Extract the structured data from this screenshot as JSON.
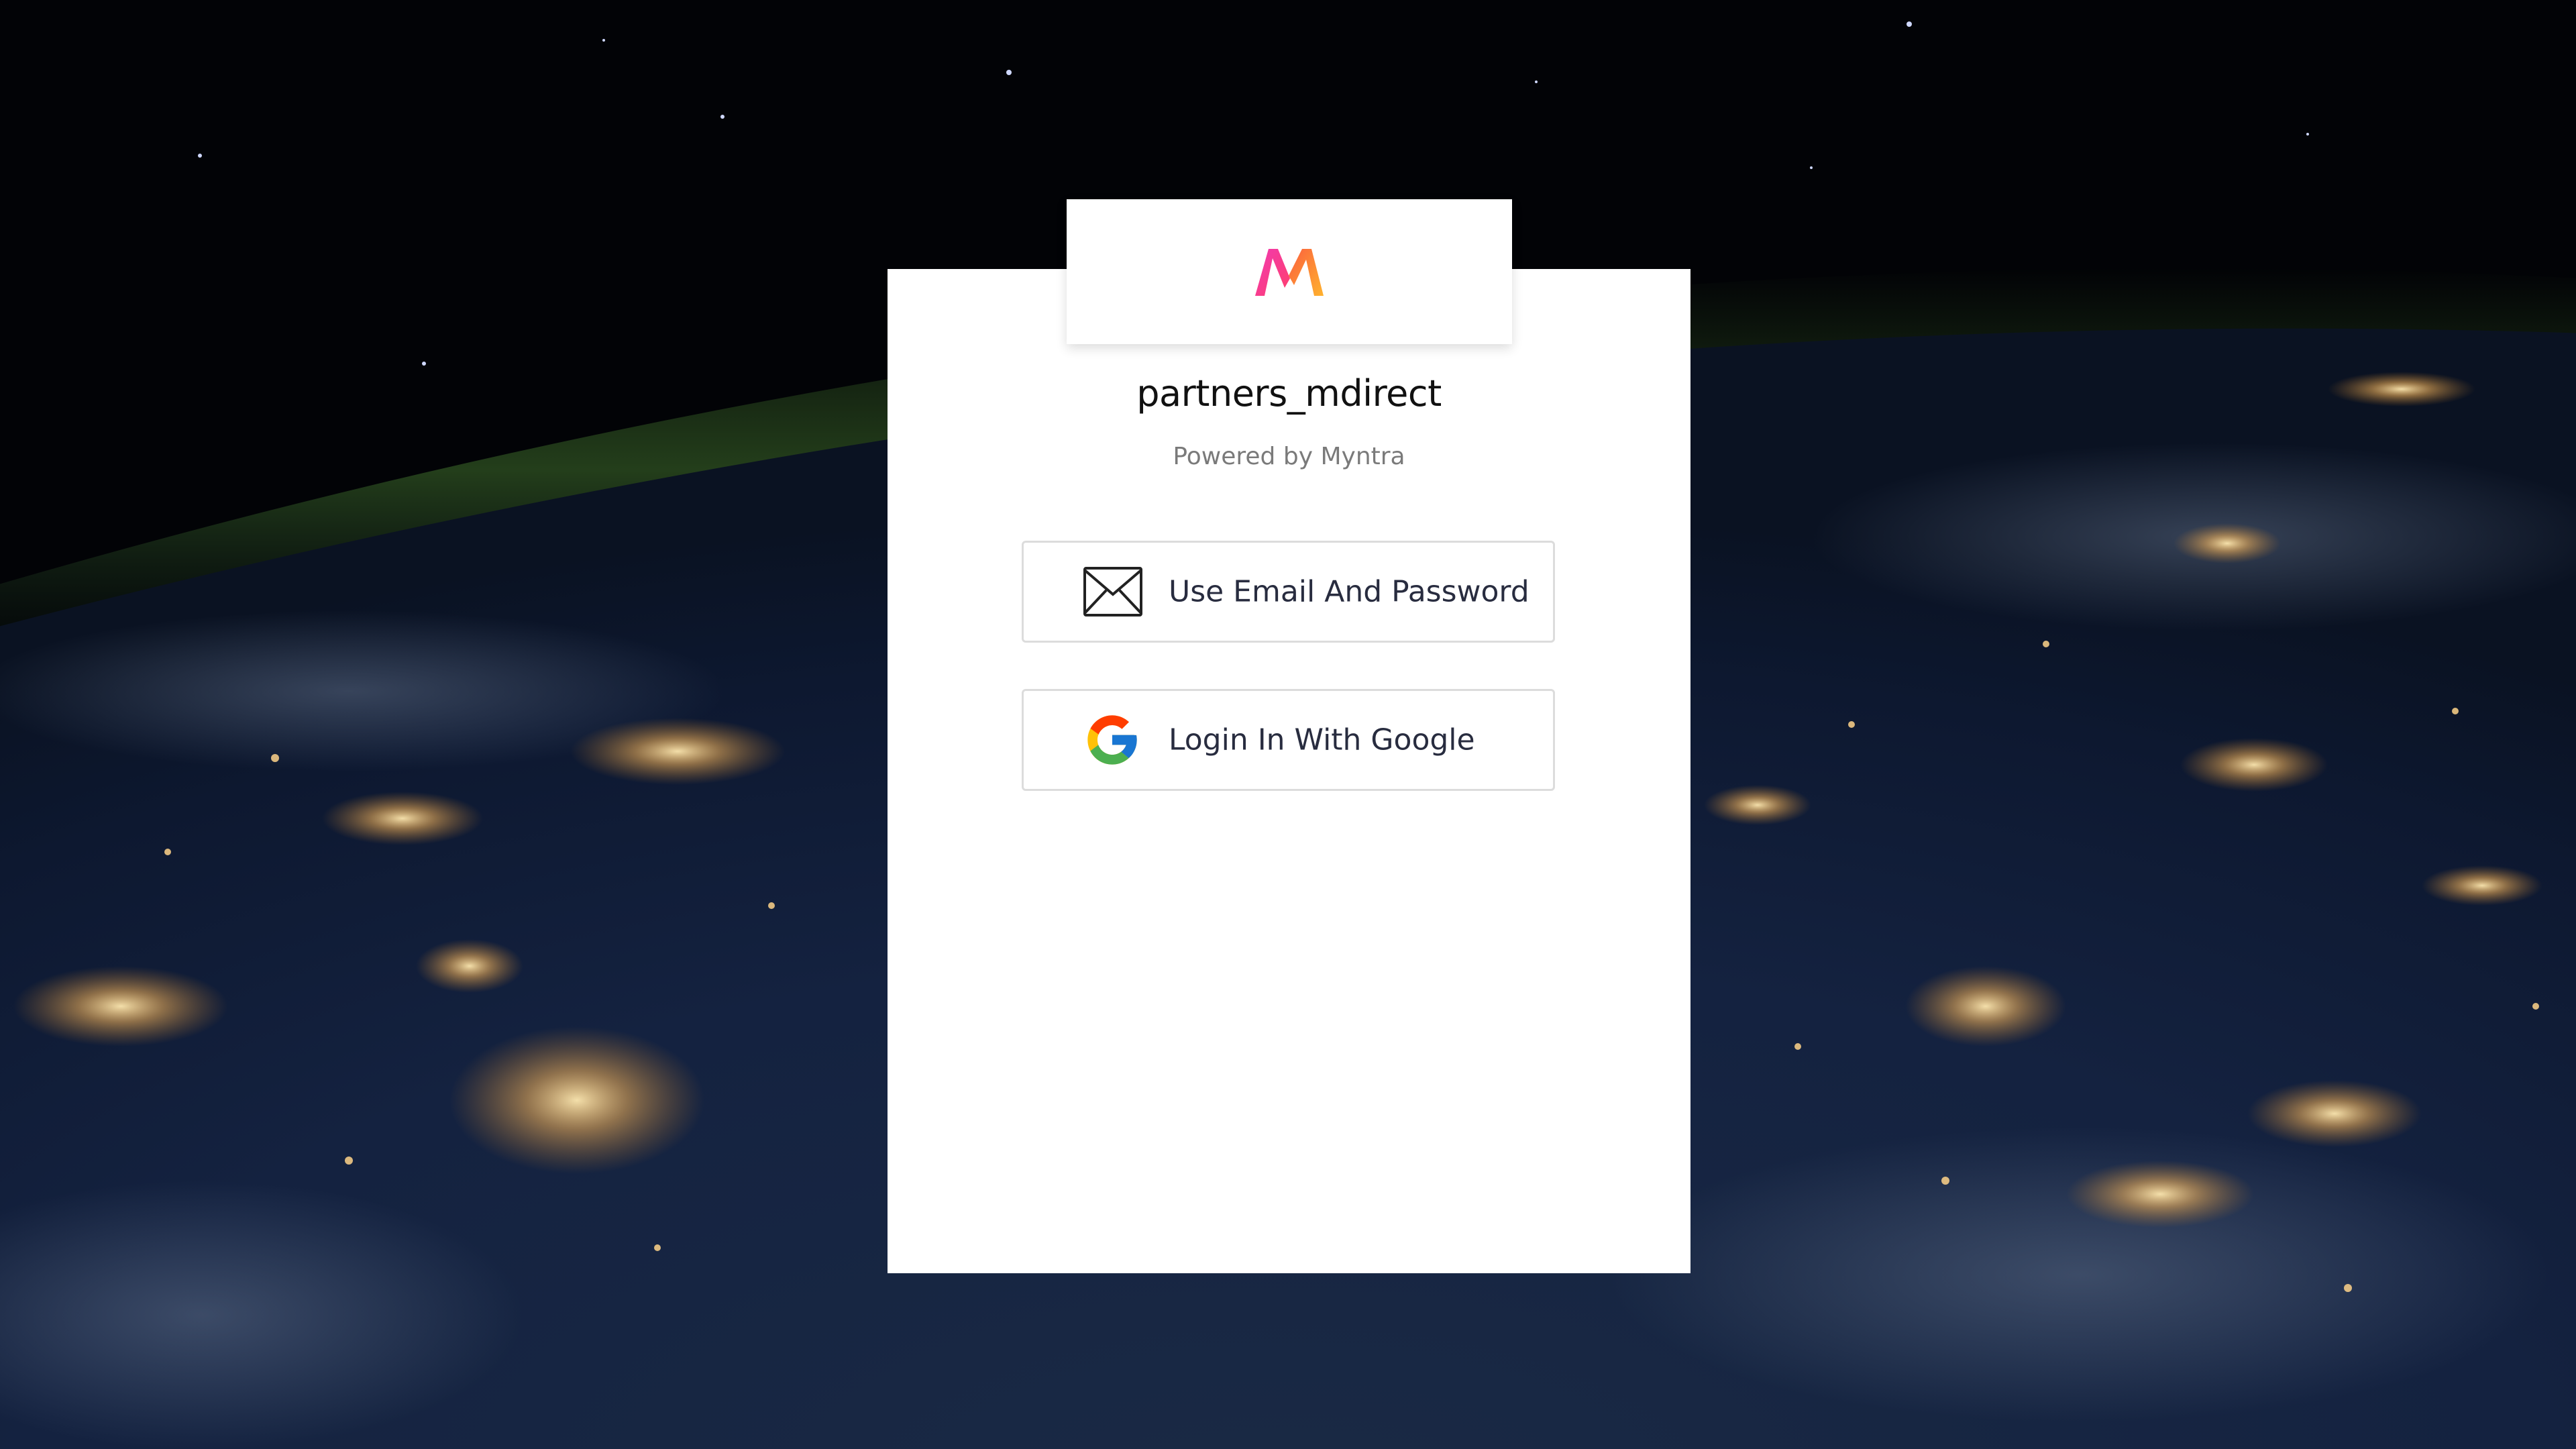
{
  "app": {
    "title": "partners_mdirect",
    "powered_by": "Powered by Myntra"
  },
  "logo": {
    "icon": "myntra-logo",
    "colors": [
      "#ff3f6c",
      "#f13ab1",
      "#fb5f3e",
      "#ffb22e"
    ]
  },
  "login_options": [
    {
      "icon": "envelope-icon",
      "label": "Use Email And Password"
    },
    {
      "icon": "google-icon",
      "label": "Login In With Google"
    }
  ],
  "background": {
    "description_colors": [
      "#000000",
      "#0b1a33",
      "#f8c070"
    ]
  }
}
